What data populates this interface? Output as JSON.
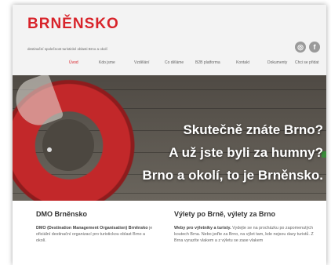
{
  "logo": {
    "left": "BRN",
    "mid": "Ě",
    "right": "NSKO"
  },
  "tagline": "destinační společnost turistické oblasti Brno a okolí",
  "social": [
    "instagram-icon",
    "facebook-icon"
  ],
  "nav": [
    {
      "label": "Úvod",
      "active": true
    },
    {
      "label": "Kdo jsme"
    },
    {
      "label": "Vzdělání"
    },
    {
      "label": "Co děláme"
    },
    {
      "label": "B2B platforma"
    },
    {
      "label": "Kontakt"
    },
    {
      "label": "Dokumenty"
    },
    {
      "label": "Chci se přidat"
    }
  ],
  "hero": {
    "line1": "Skutečně znáte Brno?",
    "line2": "A už jste byli za humny?",
    "line3": "Brno a okolí, to je Brněnsko."
  },
  "left_col": {
    "title": "DMO Brněnsko",
    "bold": "DMO (Destination Management Organisation) Brněnsko",
    "text": " je oficiální destinační organizací pro turistickou oblast Brno a okolí."
  },
  "right_col": {
    "title": "Výlety po Brně, výlety za Brno",
    "bold": "Weby pro výletníky a turisty.",
    "text": " Vydejte se na procházku po zapomenutých koutech Brna. Nebo jeďte za Brno, na výlet tam, kde nejsou davy turistů. Z Brna vyrazíte vlakem a z výletu se zase vlakem"
  },
  "colors": {
    "brand": "#d8232a",
    "hero_text": "#ffffff"
  }
}
